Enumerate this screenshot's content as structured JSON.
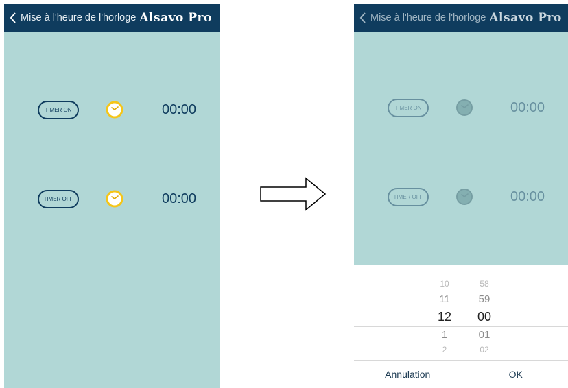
{
  "colors": {
    "header_bg": "#0f3c5e",
    "screen_bg": "#b1d7d6",
    "accent_clock": "#f5c518",
    "text_dark": "#0f3c5e"
  },
  "left": {
    "header": {
      "back_icon": "chevron-left-icon",
      "title": "Mise à l'heure de l'horloge",
      "brand": "Alsavo Pro"
    },
    "timer_on": {
      "button_label": "TIMER ON",
      "icon": "clock-icon",
      "time": "00:00"
    },
    "timer_off": {
      "button_label": "TIMER OFF",
      "icon": "clock-icon",
      "time": "00:00"
    }
  },
  "arrow": {
    "icon": "right-arrow-icon"
  },
  "right": {
    "header": {
      "back_icon": "chevron-left-icon",
      "title": "Mise à l'heure de l'horloge",
      "brand": "Alsavo Pro"
    },
    "timer_on": {
      "button_label": "TIMER ON",
      "icon": "clock-icon",
      "time": "00:00"
    },
    "timer_off": {
      "button_label": "TIMER OFF",
      "icon": "clock-icon",
      "time": "00:00"
    },
    "picker": {
      "hours": [
        "10",
        "11",
        "12",
        "1",
        "2"
      ],
      "minutes": [
        "58",
        "59",
        "00",
        "01",
        "02"
      ],
      "selected_hour": "12",
      "selected_minute": "00",
      "cancel_label": "Annulation",
      "ok_label": "OK"
    }
  }
}
